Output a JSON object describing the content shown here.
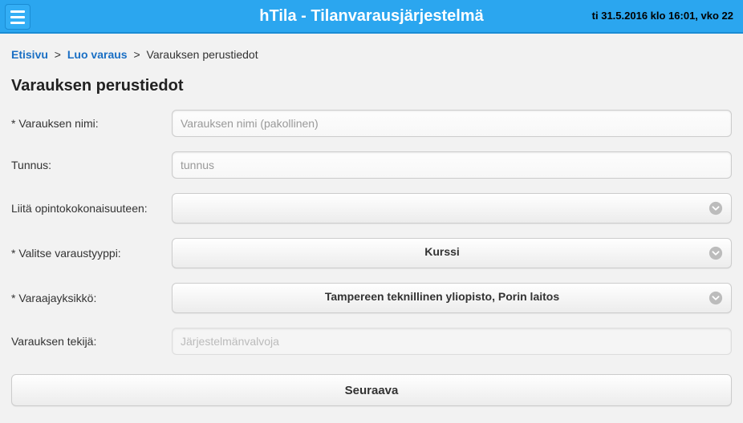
{
  "header": {
    "app_title": "hTila - Tilanvarausjärjestelmä",
    "datetime": "ti 31.5.2016 klo 16:01, vko 22"
  },
  "breadcrumb": {
    "home": "Etisivu",
    "step1": "Luo varaus",
    "current": "Varauksen perustiedot"
  },
  "page_title": "Varauksen perustiedot",
  "form": {
    "name_label": "* Varauksen nimi:",
    "name_placeholder": "Varauksen nimi (pakollinen)",
    "name_value": "",
    "code_label": "Tunnus:",
    "code_placeholder": "tunnus",
    "code_value": "",
    "course_label": "Liitä opintokokonaisuuteen:",
    "course_value": "",
    "type_label": "* Valitse varaustyyppi:",
    "type_value": "Kurssi",
    "unit_label": "* Varaajayksikkö:",
    "unit_value": "Tampereen teknillinen yliopisto, Porin laitos",
    "creator_label": "Varauksen tekijä:",
    "creator_value": "Järjestelmänvalvoja"
  },
  "next_button": "Seuraava"
}
